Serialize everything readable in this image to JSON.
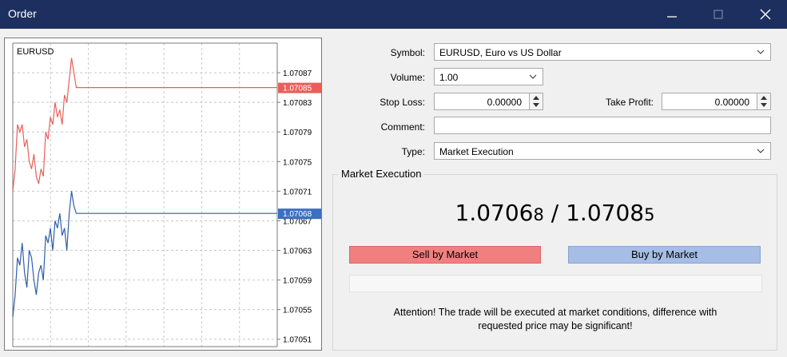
{
  "window": {
    "title": "Order",
    "minimize_icon": "minimize-icon",
    "maximize_icon": "maximize-icon",
    "close_icon": "close-icon"
  },
  "chart": {
    "symbol_label": "EURUSD",
    "price_ticks": [
      "1.07087",
      "1.07083",
      "1.07079",
      "1.07075",
      "1.07071",
      "1.07067",
      "1.07063",
      "1.07059",
      "1.07055",
      "1.07051"
    ],
    "ask_label": "1.07085",
    "bid_label": "1.07068",
    "colors": {
      "ask": "#e8605a",
      "bid": "#2e5ea8",
      "ask_tag": "#e8605a",
      "bid_tag": "#3a6fc4"
    }
  },
  "chart_data": {
    "type": "line",
    "title": "EURUSD",
    "xlabel": "",
    "ylabel": "",
    "ylim": [
      1.0705,
      1.07091
    ],
    "grid": true,
    "series": [
      {
        "values": [
          1.07071,
          1.07074,
          1.0708,
          1.07079,
          1.0708,
          1.07077,
          1.07078,
          1.07075,
          1.07074,
          1.07076,
          1.07073,
          1.07072,
          1.07074,
          1.07073,
          1.07079,
          1.07078,
          1.07081,
          1.0708,
          1.07083,
          1.07081,
          1.07082,
          1.0708,
          1.07084,
          1.07083,
          1.07086,
          1.07089,
          1.07087,
          1.07085,
          1.07085,
          1.07085,
          1.07085
        ]
      },
      {
        "values": [
          1.07054,
          1.07057,
          1.07062,
          1.07061,
          1.07064,
          1.0706,
          1.07058,
          1.07063,
          1.07062,
          1.07059,
          1.07057,
          1.0706,
          1.07061,
          1.07059,
          1.07065,
          1.07064,
          1.07066,
          1.07063,
          1.07067,
          1.07066,
          1.07068,
          1.07065,
          1.07066,
          1.07063,
          1.07068,
          1.07071,
          1.07069,
          1.07068,
          1.07068,
          1.07068,
          1.07068
        ]
      }
    ]
  },
  "form": {
    "symbol_label": "Symbol:",
    "symbol_value": "EURUSD, Euro vs US Dollar",
    "volume_label": "Volume:",
    "volume_value": "1.00",
    "stoploss_label": "Stop Loss:",
    "stoploss_value": "0.00000",
    "takeprofit_label": "Take Profit:",
    "takeprofit_value": "0.00000",
    "comment_label": "Comment:",
    "comment_value": "",
    "type_label": "Type:",
    "type_value": "Market Execution"
  },
  "execution": {
    "group_title": "Market Execution",
    "bid_main": "1.0706",
    "bid_last": "8",
    "separator": " / ",
    "ask_main": "1.0708",
    "ask_last": "5",
    "sell_label": "Sell by Market",
    "buy_label": "Buy by Market",
    "attention_line1": "Attention! The trade will be executed at market conditions, difference with",
    "attention_line2": "requested price may be significant!",
    "colors": {
      "sell": "#f08080",
      "buy": "#a6bde6"
    }
  }
}
